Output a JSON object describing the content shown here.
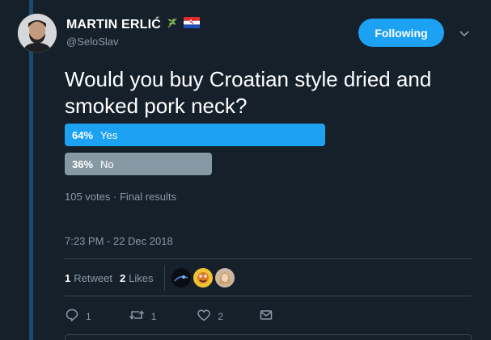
{
  "tweet": {
    "display_name": "MARTIN ERLIĆ",
    "handle": "@SeloSlav",
    "follow_label": "Following",
    "text": "Would you buy Croatian style dried and smoked pork neck?",
    "timestamp": "7:23 PM - 22 Dec 2018"
  },
  "poll": {
    "options": [
      {
        "percent_label": "64%",
        "label": "Yes",
        "percent": 64,
        "color": "#1da1f2"
      },
      {
        "percent_label": "36%",
        "label": "No",
        "percent": 36,
        "color": "#8899a6"
      }
    ],
    "votes": "105 votes",
    "status": "Final results"
  },
  "stats": {
    "retweets_count": "1",
    "retweets_label": "Retweet",
    "likes_count": "2",
    "likes_label": "Likes"
  },
  "actions": {
    "reply_count": "1",
    "retweet_count": "1",
    "like_count": "2"
  },
  "icons": {
    "name_badges": [
      "olive-branch-icon",
      "croatian-flag-icon"
    ],
    "caret": "chevron-down-icon",
    "reply": "reply-icon",
    "retweet": "retweet-icon",
    "like": "heart-icon",
    "message": "message-icon"
  },
  "colors": {
    "background": "#15202b",
    "accent": "#1da1f2",
    "muted": "#8899a6",
    "divider": "#38444d"
  }
}
